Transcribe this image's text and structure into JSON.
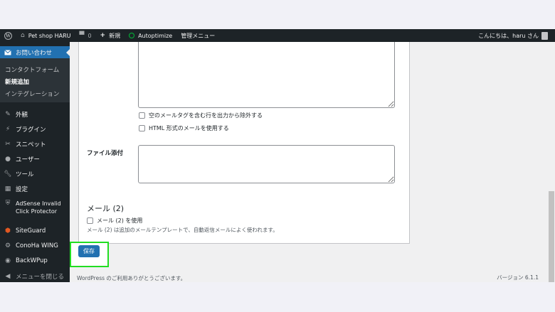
{
  "adminbar": {
    "site_name": "Pet shop HARU",
    "comments_count": "0",
    "new_label": "新規",
    "autoptimize_label": "Autoptimize",
    "manage_menu_label": "管理メニュー",
    "greeting": "こんにちは、haru さん"
  },
  "sidebar": {
    "current": "お問い合わせ",
    "submenu": [
      "コンタクトフォーム",
      "新規追加",
      "インテグレーション"
    ],
    "items": [
      "外観",
      "プラグイン",
      "スニペット",
      "ユーザー",
      "ツール",
      "設定",
      "AdSense Invalid",
      "Click Protector",
      "SiteGuard",
      "ConoHa WING",
      "BackWPup",
      "メニューを閉じる"
    ]
  },
  "form": {
    "checkbox_exclude": "空のメールタグを含む行を出力から除外する",
    "checkbox_html": "HTML 形式のメールを使用する",
    "attachment_label": "ファイル添付",
    "mail2_title": "メール (2)",
    "mail2_checkbox": "メール (2) を使用",
    "mail2_desc": "メール (2) は追加のメールテンプレートで、自動返信メールによく使われます。",
    "save_label": "保存"
  },
  "footer": {
    "left_text": "WordPress のご利用ありがとうございます。",
    "version": "バージョン 6.1.1"
  },
  "colors": {
    "admin_dark": "#1d2327",
    "accent": "#2271b1",
    "highlight": "#22dd22"
  }
}
